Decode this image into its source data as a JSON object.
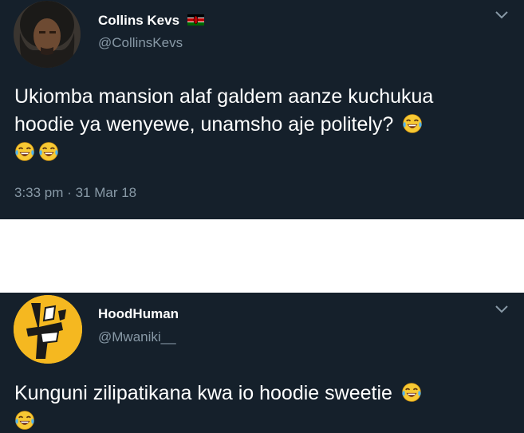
{
  "tweets": [
    {
      "name": "Collins Kevs",
      "handle": "@CollinsKevs",
      "text_line1": "Ukiomba mansion alaf galdem aanze kuchukua",
      "text_line2": "hoodie ya wenyewe, unamsho aje politely?",
      "time": "3:33 pm",
      "separator": "·",
      "date": "31 Mar 18",
      "flag_icon": "kenya-flag-icon",
      "emoji_icon": "face-with-tears-of-joy-icon",
      "emoji_count": 3
    },
    {
      "name": "HoodHuman",
      "handle": "@Mwaniki__",
      "text_line1": "Kunguni zilipatikana kwa io hoodie sweetie",
      "emoji_icon": "face-with-tears-of-joy-icon",
      "emoji_count": 2
    }
  ],
  "colors": {
    "background": "#15202b",
    "text": "#ffffff",
    "secondary_text": "#8899a6",
    "divider": "#ffffff"
  }
}
